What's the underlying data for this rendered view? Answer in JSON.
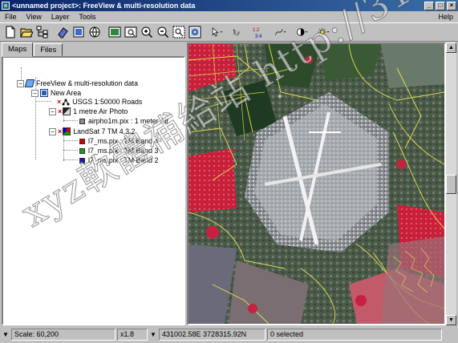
{
  "window": {
    "title": "<unnamed project>: FreeView & multi-resolution data",
    "minimize": "_",
    "maximize": "□",
    "close": "×"
  },
  "menu": {
    "file": "File",
    "view": "View",
    "layer": "Layer",
    "tools": "Tools",
    "help": "Help"
  },
  "toolbar": {
    "xy_label": "x,y",
    "ratio_label": "1:2 3:4"
  },
  "tabs": {
    "maps": "Maps",
    "files": "Files"
  },
  "tree": {
    "project": "FreeView & multi-resolution data",
    "area": "New Area",
    "roads": "USGS 1:50000 Roads",
    "airphoto_group": "1 metre Air Photo",
    "airphoto_file": "airpho1m.pix : 1 meter Air",
    "landsat_group": "LandSat 7 TM 4,3,2",
    "band4": "l7_ms.pix : TM Band 4",
    "band3": "l7_ms.pix : TM Band 3",
    "band2": "l7_ms.pix : TM Band 2"
  },
  "colors": {
    "band4": "#d40000",
    "band3": "#19a019",
    "band2": "#1a1ab4",
    "title_bar": "#0a246a"
  },
  "status": {
    "scale": "Scale: 60,200",
    "zoom": "x1.8",
    "coords": "431002.58E 3728315.92N",
    "selection": "0 selected"
  },
  "watermark": "xyz軟體補給站 http://31.to"
}
